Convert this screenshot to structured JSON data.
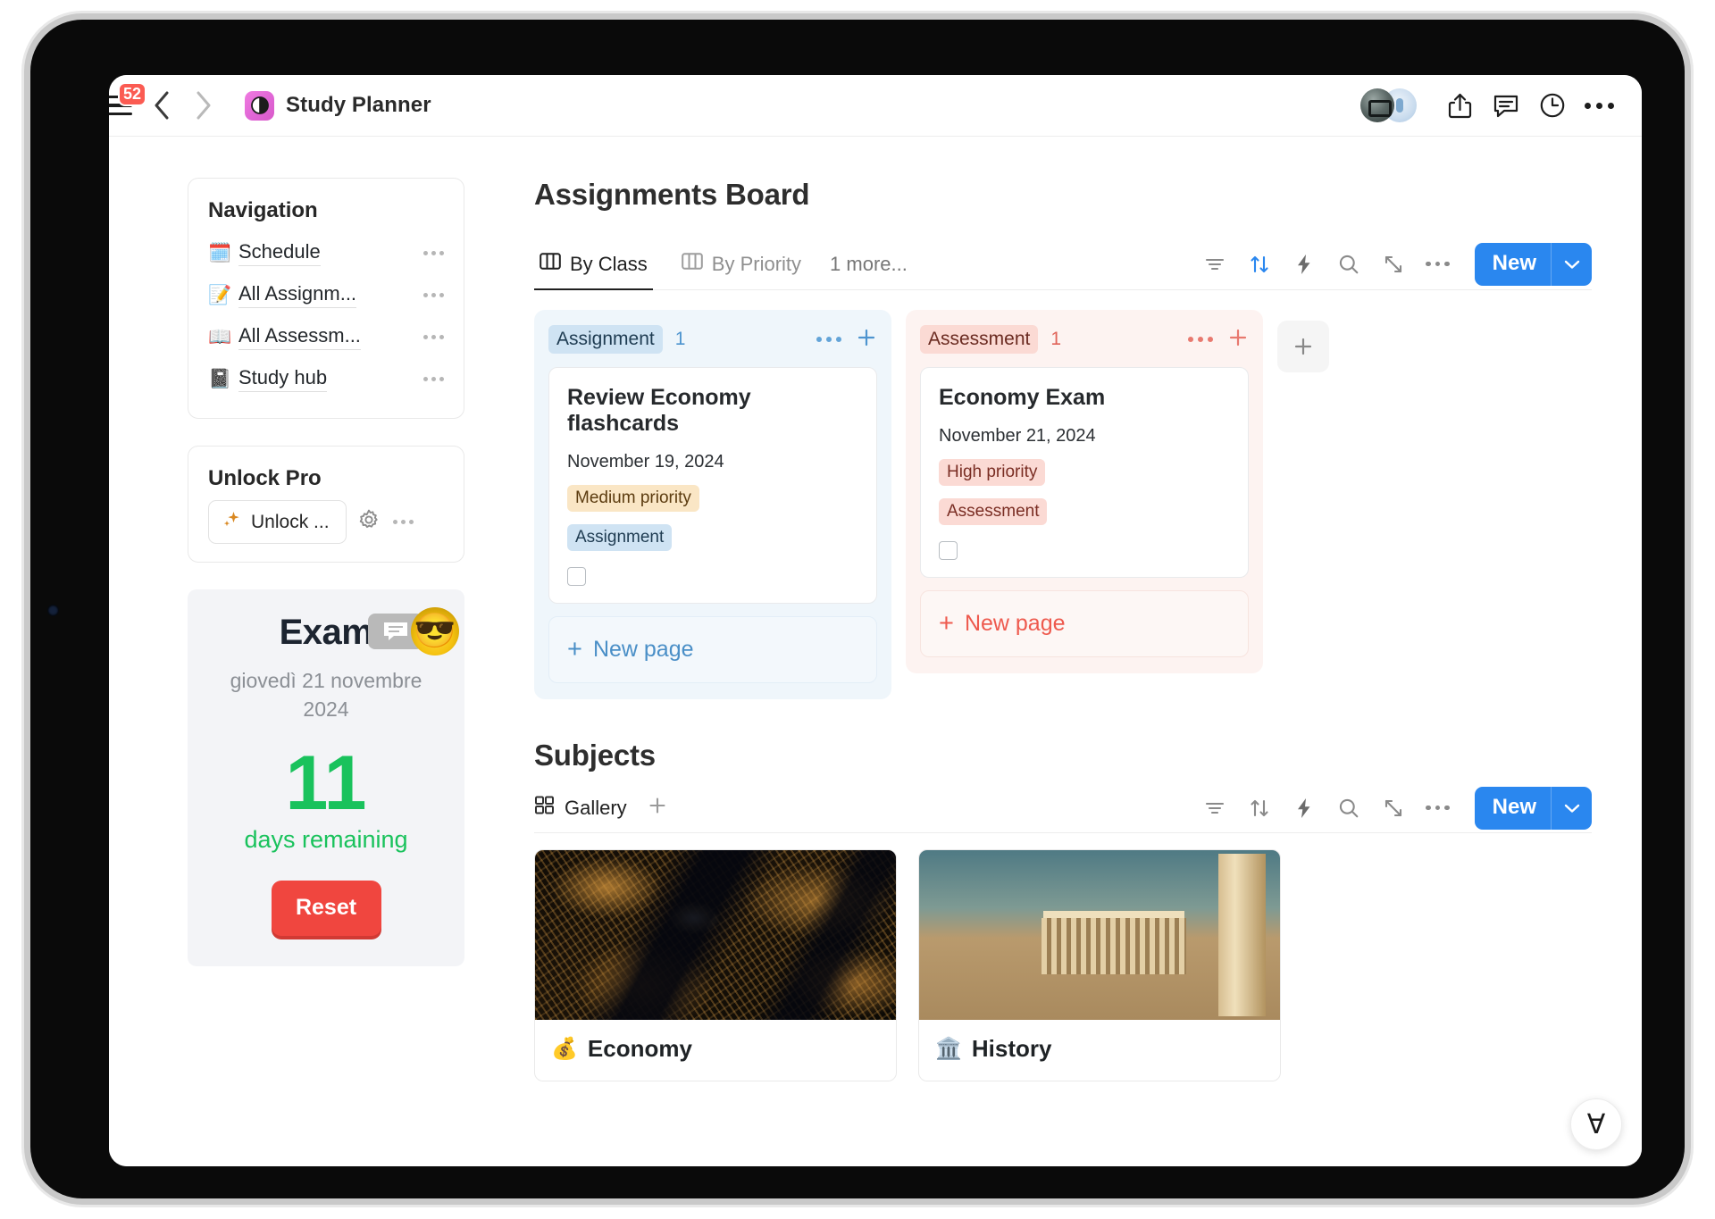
{
  "appbar": {
    "nav_badge": "52",
    "page_title": "Study Planner",
    "icons": {
      "menu": "hamburger-menu-icon",
      "back": "chevron-left-icon",
      "forward": "chevron-right-icon",
      "page": "brain-icon",
      "share": "share-icon",
      "comment": "comment-icon",
      "history": "clock-history-icon",
      "more": "more-options-icon"
    }
  },
  "sidebar": {
    "navigation": {
      "title": "Navigation",
      "items": [
        {
          "emoji": "🗓️",
          "label": "Schedule",
          "icon": "calendar-icon"
        },
        {
          "emoji": "📝",
          "label": "All Assignm...",
          "icon": "memo-icon"
        },
        {
          "emoji": "📖",
          "label": "All Assessm...",
          "icon": "book-icon"
        },
        {
          "emoji": "📓",
          "label": "Study hub",
          "icon": "notebook-icon"
        }
      ]
    },
    "unlock": {
      "title": "Unlock Pro",
      "button_label": "Unlock ...",
      "sparkle_icon": "sparkles-icon",
      "gear_icon": "gear-icon"
    },
    "countdown": {
      "title": "Exam",
      "date": "giovedì 21 novembre 2024",
      "number": "11",
      "unit": "days remaining",
      "reset_label": "Reset",
      "emoji": "😎",
      "comment_icon": "comment-icon"
    }
  },
  "main": {
    "board": {
      "title": "Assignments Board",
      "tabs": [
        {
          "label": "By Class",
          "active": true,
          "icon": "board-view-icon"
        },
        {
          "label": "By Priority",
          "active": false,
          "icon": "board-view-icon"
        }
      ],
      "more_views": "1 more...",
      "toolbar": {
        "filter": "filter-icon",
        "sort": "sort-icon",
        "automation": "lightning-icon",
        "search": "search-icon",
        "expand": "expand-icon",
        "more": "more-options-icon",
        "new_label": "New",
        "new_caret": "chevron-down-icon",
        "accent": "#2a87ef",
        "sort_active_color": "#2a87ef"
      },
      "columns": [
        {
          "name": "Assignment",
          "count": "1",
          "theme": "blue",
          "cards": [
            {
              "title": "Review Economy flashcards",
              "date": "November 19, 2024",
              "priority": "Medium priority",
              "type": "Assignment",
              "checked": false
            }
          ],
          "new_page_label": "New page"
        },
        {
          "name": "Assessment",
          "count": "1",
          "theme": "red",
          "cards": [
            {
              "title": "Economy Exam",
              "date": "November 21, 2024",
              "priority": "High priority",
              "type": "Assessment",
              "checked": false
            }
          ],
          "new_page_label": "New page"
        }
      ],
      "add_column_icon": "plus-icon"
    },
    "subjects": {
      "title": "Subjects",
      "view_label": "Gallery",
      "view_icon": "gallery-view-icon",
      "add_view_icon": "plus-icon",
      "toolbar": {
        "filter": "filter-icon",
        "sort": "sort-icon",
        "automation": "lightning-icon",
        "search": "search-icon",
        "expand": "expand-icon",
        "more": "more-options-icon",
        "new_label": "New",
        "new_caret": "chevron-down-icon"
      },
      "cards": [
        {
          "emoji": "💰",
          "label": "Economy",
          "image": "city-at-night-satellite"
        },
        {
          "emoji": "🏛️",
          "label": "History",
          "image": "parthenon-painting"
        }
      ]
    }
  },
  "ai_fab": {
    "glyph": "Ɐ",
    "icon": "notion-ai-icon"
  }
}
